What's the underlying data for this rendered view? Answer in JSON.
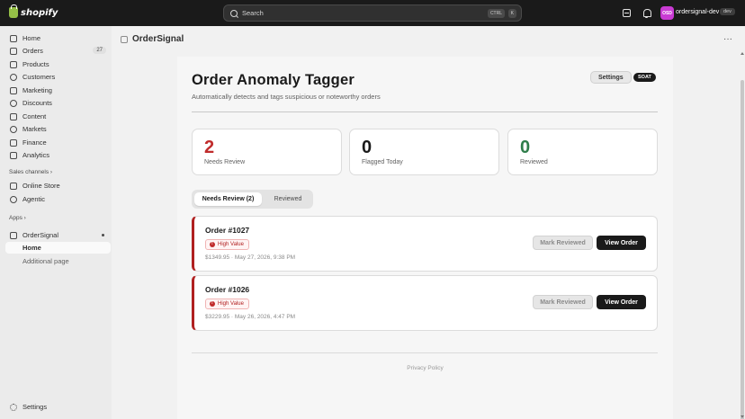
{
  "topbar": {
    "brand": "shopify",
    "search_placeholder": "Search",
    "shortcut_key1": "CTRL",
    "shortcut_key2": "K",
    "avatar_initials": "OSD",
    "store_name": "ordersignal-dev",
    "store_badge": "dev"
  },
  "sidebar": {
    "items": [
      {
        "label": "Home",
        "icon": "home-icon"
      },
      {
        "label": "Orders",
        "icon": "orders-icon",
        "count": "27"
      },
      {
        "label": "Products",
        "icon": "products-icon"
      },
      {
        "label": "Customers",
        "icon": "customers-icon"
      },
      {
        "label": "Marketing",
        "icon": "marketing-icon"
      },
      {
        "label": "Discounts",
        "icon": "discounts-icon"
      },
      {
        "label": "Content",
        "icon": "content-icon"
      },
      {
        "label": "Markets",
        "icon": "markets-icon"
      },
      {
        "label": "Finance",
        "icon": "finance-icon"
      },
      {
        "label": "Analytics",
        "icon": "analytics-icon"
      }
    ],
    "sales_channels_label": "Sales channels",
    "channels": [
      {
        "label": "Online Store",
        "icon": "store-icon"
      },
      {
        "label": "Agentic",
        "icon": "agentic-icon"
      }
    ],
    "apps_label": "Apps",
    "app_name": "OrderSignal",
    "app_subitems": [
      "Home",
      "Additional page"
    ],
    "settings_label": "Settings"
  },
  "app_header": {
    "title": "OrderSignal"
  },
  "page": {
    "title": "Order Anomaly Tagger",
    "subtitle": "Automatically detects and tags suspicious or noteworthy orders",
    "settings_button": "Settings",
    "badge": "SOAT"
  },
  "stats": [
    {
      "value": "2",
      "label": "Needs Review",
      "color": "#c02c2c"
    },
    {
      "value": "0",
      "label": "Flagged Today",
      "color": "#1a1a1a"
    },
    {
      "value": "0",
      "label": "Reviewed",
      "color": "#2e7d4a"
    }
  ],
  "tabs": [
    {
      "label": "Needs Review (2)",
      "active": true
    },
    {
      "label": "Reviewed",
      "active": false
    }
  ],
  "orders": [
    {
      "title": "Order #1027",
      "tag": "High Value",
      "meta": "$1349.95 · May 27, 2026, 9:38 PM",
      "mark_label": "Mark Reviewed",
      "view_label": "View Order"
    },
    {
      "title": "Order #1026",
      "tag": "High Value",
      "meta": "$3229.95 · May 26, 2026, 4:47 PM",
      "mark_label": "Mark Reviewed",
      "view_label": "View Order"
    }
  ],
  "footer": {
    "link": "Privacy Policy"
  },
  "colors": {
    "accent_danger": "#b02020",
    "topbar": "#1a1a1a",
    "avatar": "#c93bd3"
  }
}
